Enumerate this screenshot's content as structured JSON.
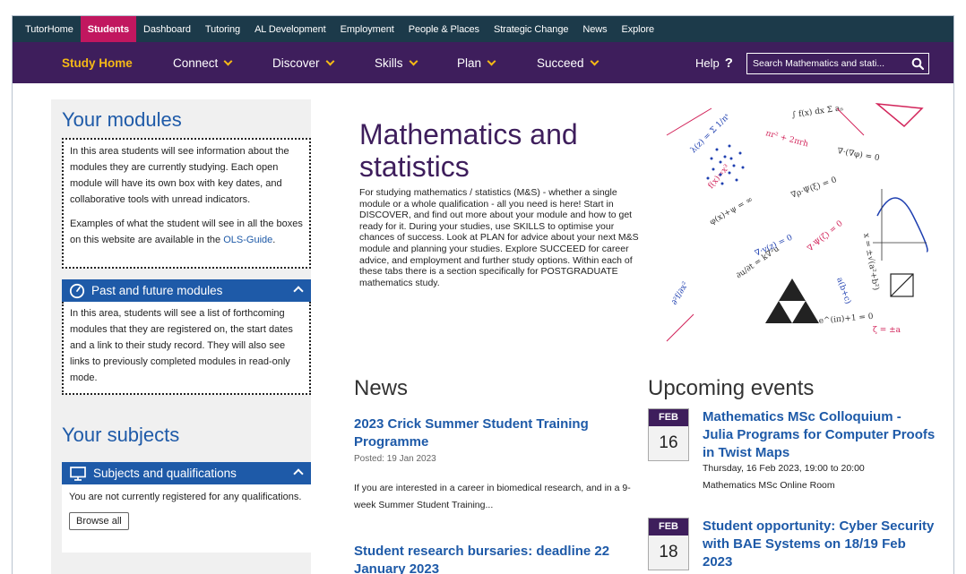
{
  "topbar": {
    "tabs": [
      "TutorHome",
      "Students",
      "Dashboard",
      "Tutoring",
      "AL Development",
      "Employment",
      "People & Places",
      "Strategic Change",
      "News",
      "Explore"
    ],
    "active": "Students"
  },
  "nav": {
    "home": "Study Home",
    "items": [
      "Connect",
      "Discover",
      "Skills",
      "Plan",
      "Succeed"
    ],
    "help": "Help",
    "help_icon": "?",
    "search_placeholder": "Search Mathematics and stati..."
  },
  "left": {
    "modules_title": "Your modules",
    "modules_text_1": "In this area students will see information about the modules they are currently studying. Each open module will have its own box with key dates, and collaborative tools with unread indicators.",
    "modules_text_2": "Examples of what the student will see in all the boxes on this website are available in the",
    "modules_link": "OLS-Guide",
    "modules_text_3": ".",
    "past_future_title": "Past and future modules",
    "past_future_text": "In this area, students will see a list of forthcoming modules that they are registered on, the start dates and a link to their study record. They will also see links to previously completed modules in read-only mode.",
    "subjects_title": "Your subjects",
    "subjects_head": "Subjects and qualifications",
    "subjects_text": "You are not currently registered for any qualifications.",
    "browse_label": "Browse all"
  },
  "main": {
    "title": "Mathematics and statistics",
    "intro": "For studying mathematics / statistics (M&S) - whether a single module or a whole qualification - all you need is here! Start in DISCOVER, and find out more about your module and how to get ready for it.  During your studies, use SKILLS to optimise your chances of success.  Look at PLAN for advice about your next M&S module and planning your studies. Explore SUCCEED for career advice, and employment and further study options.  Within each of these tabs there is a section specifically for POSTGRADUATE mathematics study."
  },
  "news": {
    "title": "News",
    "items": [
      {
        "headline": "2023 Crick Summer Student Training Programme",
        "posted": "Posted: 19 Jan 2023",
        "snippet": "If you are interested in a career in biomedical research, and in a 9-week Summer Student Training..."
      },
      {
        "headline": "Student research bursaries: deadline 22 January 2023"
      }
    ]
  },
  "events": {
    "title": "Upcoming events",
    "items": [
      {
        "month": "FEB",
        "day": "16",
        "headline": "Mathematics MSc Colloquium - Julia Programs for Computer Proofs in Twist Maps",
        "when": "Thursday, 16 Feb 2023, 19:00 to 20:00",
        "where": "Mathematics MSc Online Room"
      },
      {
        "month": "FEB",
        "day": "18",
        "headline": "Student opportunity: Cyber Security with BAE Systems on 18/19 Feb 2023"
      }
    ]
  },
  "colors": {
    "topbar": "#1c3a4a",
    "active_tab": "#c1175f",
    "nav": "#3e1e5c",
    "accent_yellow": "#f5b916",
    "link_blue": "#1e5aa8"
  },
  "icons": {
    "search": "magnifier-icon",
    "chevron": "chevron-down-icon",
    "clock": "clock-icon",
    "monitor": "monitor-icon",
    "collapse": "chevron-up-icon"
  }
}
